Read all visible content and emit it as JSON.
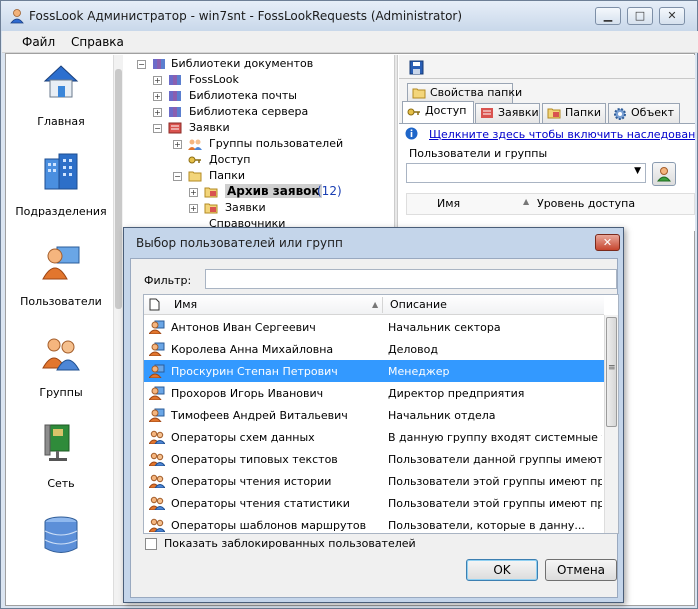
{
  "window": {
    "title": "FossLook Администратор - win7snt - FossLookRequests (Administrator)"
  },
  "menu": {
    "file": "Файл",
    "help": "Справка"
  },
  "sidebar": {
    "items": [
      {
        "label": "Главная",
        "icon": "home-icon"
      },
      {
        "label": "Подразделения",
        "icon": "buildings-icon"
      },
      {
        "label": "Пользователи",
        "icon": "user-icon"
      },
      {
        "label": "Группы",
        "icon": "group-icon"
      },
      {
        "label": "Сеть",
        "icon": "network-card-icon"
      },
      {
        "label": "",
        "icon": "database-icon"
      }
    ]
  },
  "tree": {
    "root": "Библиотеки документов",
    "fosslook": "FossLook",
    "mail_library": "Библиотека почты",
    "server_library": "Библиотека сервера",
    "requests": "Заявки",
    "user_groups": "Группы пользователей",
    "access": "Доступ",
    "folders": "Папки",
    "archive": "Архив заявок",
    "archive_count": "(12)",
    "requests_sub": "Заявки",
    "references": "Справочники"
  },
  "right_panel": {
    "tab_folder_props": "Свойства папки",
    "tab_access": "Доступ",
    "tab_requests": "Заявки",
    "tab_folders": "Папки",
    "tab_object": "Объект",
    "inherit_link": "Щелкните здесь чтобы включить наследование. Д",
    "users_groups_label": "Пользователи и группы",
    "col_name": "Имя",
    "col_access_level": "Уровень доступа"
  },
  "dialog": {
    "title": "Выбор пользователей или групп",
    "close": "✕",
    "filter_label": "Фильтр:",
    "filter_value": "",
    "col_name": "Имя",
    "col_description": "Описание",
    "rows": [
      {
        "name": "Антонов Иван Сергеевич",
        "description": "Начальник сектора",
        "type": "user"
      },
      {
        "name": "Королева Анна Михайловна",
        "description": "Деловод",
        "type": "user"
      },
      {
        "name": "Проскурин Степан Петрович",
        "description": "Менеджер",
        "type": "user"
      },
      {
        "name": "Прохоров Игорь Иванович",
        "description": "Директор предприятия",
        "type": "user"
      },
      {
        "name": "Тимофеев Андрей Витальевич",
        "description": "Начальник отдела",
        "type": "user"
      },
      {
        "name": "Операторы схем данных",
        "description": "В данную группу входят системные уче...",
        "type": "group"
      },
      {
        "name": "Операторы типовых текстов",
        "description": "Пользователи данной группы имеют пр...",
        "type": "group"
      },
      {
        "name": "Операторы чтения истории",
        "description": "Пользователи этой группы имеют прав...",
        "type": "group"
      },
      {
        "name": "Операторы чтения статистики",
        "description": "Пользователи этой группы имеют прав...",
        "type": "group"
      },
      {
        "name": "Операторы шаблонов маршрутов",
        "description": "Пользователи, которые в данну...",
        "type": "group"
      }
    ],
    "selected_row": 2,
    "show_blocked_label": "Показать заблокированных пользователей",
    "ok": "OK",
    "cancel": "Отмена"
  },
  "colors": {
    "selection": "#3399ff",
    "link": "#0000cc",
    "count": "#1a3fb3"
  }
}
